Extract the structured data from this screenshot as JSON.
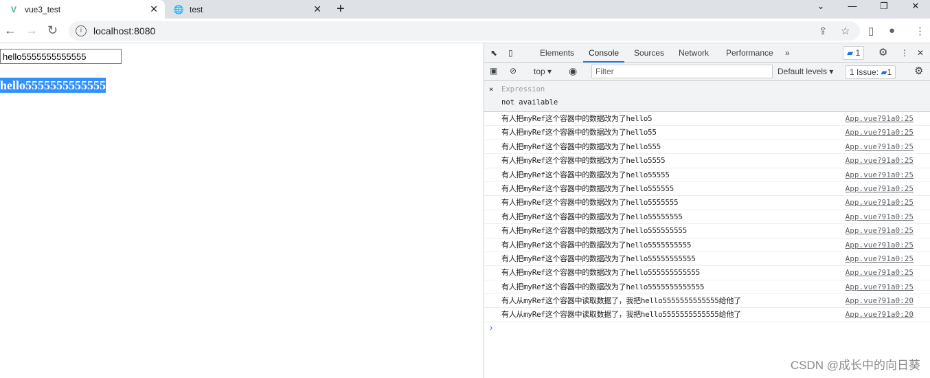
{
  "browser": {
    "tabs": [
      {
        "title": "vue3_test",
        "icon": "vue-logo-icon",
        "active": true
      },
      {
        "title": "test",
        "icon": "globe-icon",
        "active": false
      }
    ],
    "url": "localhost:8080"
  },
  "page": {
    "input_value": "hello5555555555555",
    "heading": "hello5555555555555"
  },
  "devtools": {
    "tabs": [
      "Elements",
      "Console",
      "Sources",
      "Network",
      "Performance"
    ],
    "active_tab": "Console",
    "issues_badge": "1",
    "context": "top",
    "filter_placeholder": "Filter",
    "levels": "Default levels",
    "issues_label": "1 Issue:",
    "issues_count": "1",
    "expression": {
      "label": "Expression",
      "value": "not available"
    },
    "logs": [
      {
        "msg": "有人把myRef这个容器中的数据改为了hello5",
        "src": "App.vue?91a0:25"
      },
      {
        "msg": "有人把myRef这个容器中的数据改为了hello55",
        "src": "App.vue?91a0:25"
      },
      {
        "msg": "有人把myRef这个容器中的数据改为了hello555",
        "src": "App.vue?91a0:25"
      },
      {
        "msg": "有人把myRef这个容器中的数据改为了hello5555",
        "src": "App.vue?91a0:25"
      },
      {
        "msg": "有人把myRef这个容器中的数据改为了hello55555",
        "src": "App.vue?91a0:25"
      },
      {
        "msg": "有人把myRef这个容器中的数据改为了hello555555",
        "src": "App.vue?91a0:25"
      },
      {
        "msg": "有人把myRef这个容器中的数据改为了hello5555555",
        "src": "App.vue?91a0:25"
      },
      {
        "msg": "有人把myRef这个容器中的数据改为了hello55555555",
        "src": "App.vue?91a0:25"
      },
      {
        "msg": "有人把myRef这个容器中的数据改为了hello555555555",
        "src": "App.vue?91a0:25"
      },
      {
        "msg": "有人把myRef这个容器中的数据改为了hello5555555555",
        "src": "App.vue?91a0:25"
      },
      {
        "msg": "有人把myRef这个容器中的数据改为了hello55555555555",
        "src": "App.vue?91a0:25"
      },
      {
        "msg": "有人把myRef这个容器中的数据改为了hello555555555555",
        "src": "App.vue?91a0:25"
      },
      {
        "msg": "有人把myRef这个容器中的数据改为了hello5555555555555",
        "src": "App.vue?91a0:25"
      },
      {
        "msg": "有人从myRef这个容器中读取数据了，我把hello5555555555555给他了",
        "src": "App.vue?91a0:20"
      },
      {
        "msg": "有人从myRef这个容器中读取数据了，我把hello5555555555555给他了",
        "src": "App.vue?91a0:20"
      }
    ]
  },
  "watermark": "CSDN @成长中的向日葵"
}
